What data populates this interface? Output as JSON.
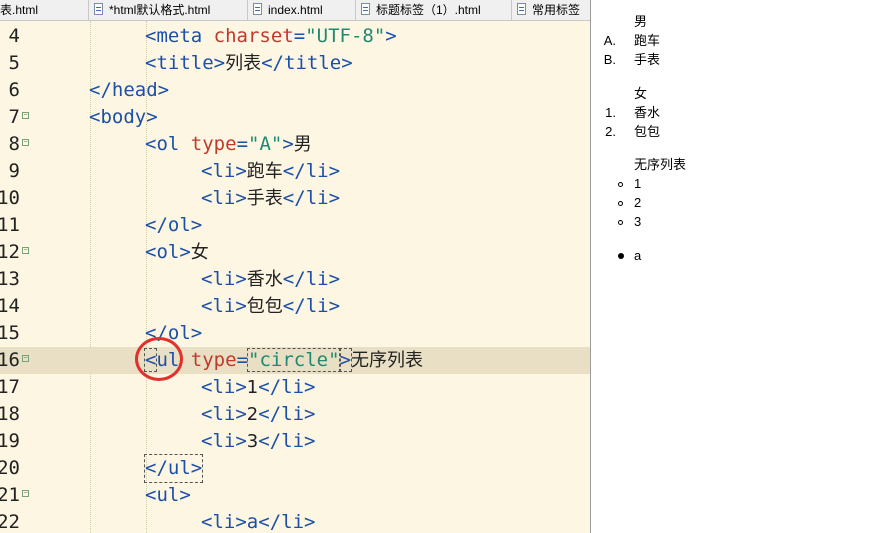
{
  "editor": {
    "tabs": [
      {
        "label": "列表.html"
      },
      {
        "label": "*html默认格式.html"
      },
      {
        "label": "index.html"
      },
      {
        "label": "标题标签（1）.html"
      },
      {
        "label": "常用标签"
      }
    ],
    "line_numbers": [
      "4",
      "5",
      "6",
      "7",
      "8",
      "9",
      "10",
      "11",
      "12",
      "13",
      "14",
      "15",
      "16",
      "17",
      "18",
      "19",
      "20",
      "21",
      "22"
    ],
    "folded_lines": [
      "7",
      "8",
      "12",
      "16",
      "21"
    ],
    "highlighted_line": "16",
    "lines": {
      "l4": [
        "<",
        "meta",
        " ",
        "charset",
        "=",
        "\"UTF-8\"",
        ">"
      ],
      "l5": [
        "<",
        "title",
        ">",
        "列表",
        "</",
        "title",
        ">"
      ],
      "l6": [
        "</",
        "head",
        ">"
      ],
      "l7": [
        "<",
        "body",
        ">"
      ],
      "l8": [
        "<",
        "ol",
        " ",
        "type",
        "=",
        "\"A\"",
        ">",
        "男"
      ],
      "l9": [
        "<",
        "li",
        ">",
        "跑车",
        "</",
        "li",
        ">"
      ],
      "l10": [
        "<",
        "li",
        ">",
        "手表",
        "</",
        "li",
        ">"
      ],
      "l11": [
        "</",
        "ol",
        ">"
      ],
      "l12": [
        "<",
        "ol",
        ">",
        "女"
      ],
      "l13": [
        "<",
        "li",
        ">",
        "香水",
        "</",
        "li",
        ">"
      ],
      "l14": [
        "<",
        "li",
        ">",
        "包包",
        "</",
        "li",
        ">"
      ],
      "l15": [
        "</",
        "ol",
        ">"
      ],
      "l16": [
        "<",
        "ul",
        " ",
        "type",
        "=",
        "\"circle\"",
        ">",
        "无序列表"
      ],
      "l17": [
        "<",
        "li",
        ">",
        "1",
        "</",
        "li",
        ">"
      ],
      "l18": [
        "<",
        "li",
        ">",
        "2",
        "</",
        "li",
        ">"
      ],
      "l19": [
        "<",
        "li",
        ">",
        "3",
        "</",
        "li",
        ">"
      ],
      "l20": [
        "</",
        "ul",
        ">"
      ],
      "l21": [
        "<",
        "ul",
        ">"
      ],
      "l22": [
        "<",
        "li",
        ">",
        "a",
        "</",
        "li",
        ">"
      ]
    },
    "annotation_color": "#e0312b"
  },
  "preview": {
    "ol_upper": {
      "heading": "男",
      "markers": [
        "A.",
        "B."
      ],
      "items": [
        "跑车",
        "手表"
      ]
    },
    "ol_decimal": {
      "heading": "女",
      "markers": [
        "1.",
        "2."
      ],
      "items": [
        "香水",
        "包包"
      ]
    },
    "ul_circle": {
      "heading": "无序列表",
      "items": [
        "1",
        "2",
        "3"
      ]
    },
    "ul_disc": {
      "items": [
        "a"
      ]
    }
  }
}
